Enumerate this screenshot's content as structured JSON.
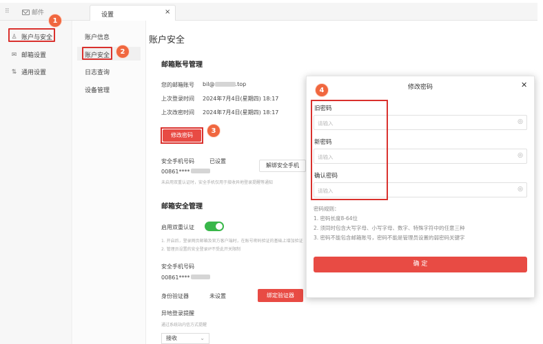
{
  "topbar": {
    "app_label": "邮件",
    "active_tab": "设置",
    "close_glyph": "×"
  },
  "sidebar": {
    "items": [
      {
        "label": "账户与安全",
        "icon": "user-icon"
      },
      {
        "label": "邮箱设置",
        "icon": "mail-settings-icon"
      },
      {
        "label": "通用设置",
        "icon": "general-settings-icon"
      }
    ]
  },
  "subnav": {
    "items": [
      {
        "label": "账户信息"
      },
      {
        "label": "账户安全"
      },
      {
        "label": "日志查询"
      },
      {
        "label": "设备管理"
      }
    ]
  },
  "badges": {
    "b1": "1",
    "b2": "2",
    "b3": "3",
    "b4": "4"
  },
  "main": {
    "page_title": "账户安全",
    "mailbox_section": "邮箱账号管理",
    "email_label": "您的邮箱账号",
    "email_prefix": "bil@",
    "email_suffix": ".top",
    "last_login_label": "上次登录时间",
    "last_login_value": "2024年7月4日(星期四) 18:17",
    "last_change_label": "上次改密时间",
    "last_change_value": "2024年7月4日(星期四) 18:17",
    "change_password_button": "修改密码",
    "security_phone_label": "安全手机号码",
    "security_phone_status": "已设置",
    "phone_value": "00861****",
    "unbind_phone_button": "解绑安全手机",
    "phone_note": "未启用双重认证时，安全手机仅用于接收异地登录提醒等通知",
    "security_section": "邮箱安全管理",
    "two_factor_label": "启用双重认证",
    "two_factor_note1": "1. 开启后，登录网页邮箱及官方客户端时，在账号密码验证的基础上增加验证",
    "two_factor_note2": "2. 管理员设置的安全登录IP不受此开关限制",
    "security_phone_label2": "安全手机号码",
    "phone_value2": "00861****",
    "authenticator_label": "身份验证器",
    "authenticator_status": "未设置",
    "bind_authenticator_button": "绑定验证器",
    "remote_login_label": "异地登录提醒",
    "remote_login_note": "通过系统站内信方式提醒",
    "remote_login_select": "接收"
  },
  "modal": {
    "title": "修改密码",
    "close_glyph": "✕",
    "old_password_label": "旧密码",
    "old_password_placeholder": "请输入",
    "new_password_label": "新密码",
    "new_password_placeholder": "请输入",
    "confirm_password_label": "确认密码",
    "confirm_password_placeholder": "请输入",
    "rules_title": "密码规则：",
    "rule1": "1. 密码长度8-64位",
    "rule2": "2. 须同时包含大写字母、小写字母、数字、特殊字符中的任意三种",
    "rule3": "3. 密码不能包含邮箱账号，密码不能是管理员设置的弱密码关键字",
    "confirm_button": "确 定"
  },
  "colors": {
    "accent_red": "#e84b44",
    "highlight_red": "#d9302c",
    "badge_orange": "#f0673f",
    "toggle_green": "#39b74a"
  }
}
